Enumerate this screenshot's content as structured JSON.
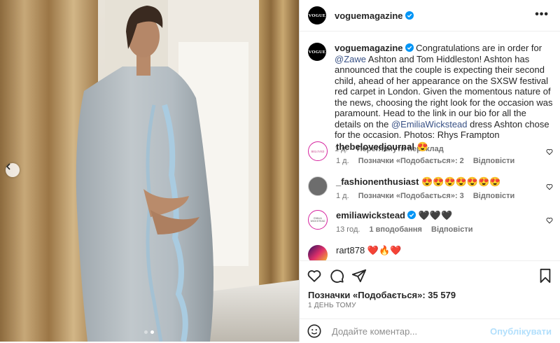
{
  "post": {
    "username": "voguemagazine",
    "avatar_text": "VOGUE",
    "more_label": "•••",
    "caption": {
      "username": "voguemagazine",
      "part1": " Congratulations are in order for ",
      "mention1": "@Zawe",
      "part2": " Ashton and Tom Hiddleston! Ashton has announced that the couple is expecting their second child, ahead of her appearance on the SXSW festival red carpet in London. Given the momentous nature of the news, choosing the right look for the occasion was paramount. Head to the link in our bio for all the details on the ",
      "mention2": "@EmiliaWickstead",
      "part3": " dress Ashton chose for the occasion. Photos: Rhys Frampton",
      "time": "1 д.",
      "translate": "Переглянути переклад"
    },
    "comments": [
      {
        "username": "thebelovedjournal",
        "text": " 😍",
        "time": "1 д.",
        "likes": "Позначки «Подобається»: 2",
        "reply": "Відповісти",
        "avatar_text": "BELOVED"
      },
      {
        "username": "_fashionenthusiast",
        "text": " 😍😍😍😍😍😍😍",
        "time": "1 д.",
        "likes": "Позначки «Подобається»: 3",
        "reply": "Відповісти",
        "avatar_text": ""
      },
      {
        "username": "emiliawickstead",
        "text": " 🖤🖤🖤",
        "time": "13 год.",
        "likes": "1 вподобання",
        "reply": "Відповісти",
        "avatar_text": "EMILIA WICKSTEAD"
      },
      {
        "username": "rart878",
        "text": " ❤️🔥❤️",
        "time": "",
        "likes": "",
        "reply": "",
        "avatar_text": ""
      }
    ],
    "likes_count": "Позначки «Подобається»: 35 579",
    "time_ago": "1 ДЕНЬ ТОМУ",
    "comment_placeholder": "Додайте коментар...",
    "publish_label": "Опублікувати",
    "image_dots": 2
  },
  "colors": {
    "verified": "#0095f6",
    "link": "#385185",
    "publish": "#b2dffc"
  }
}
